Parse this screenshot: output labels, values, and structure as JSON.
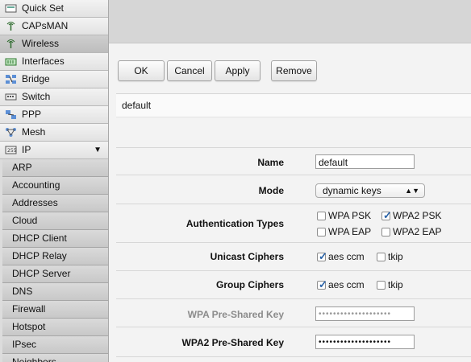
{
  "sidebar": {
    "items": [
      {
        "label": "Quick Set",
        "icon": "quick-set-icon"
      },
      {
        "label": "CAPsMAN",
        "icon": "antenna-icon"
      },
      {
        "label": "Wireless",
        "icon": "wireless-icon",
        "selected": true
      },
      {
        "label": "Interfaces",
        "icon": "interfaces-icon"
      },
      {
        "label": "Bridge",
        "icon": "bridge-icon"
      },
      {
        "label": "Switch",
        "icon": "switch-icon"
      },
      {
        "label": "PPP",
        "icon": "ppp-icon"
      },
      {
        "label": "Mesh",
        "icon": "mesh-icon"
      },
      {
        "label": "IP",
        "icon": "ip-icon",
        "expand_arrow": "▼"
      }
    ],
    "ip_subitems": [
      "ARP",
      "Accounting",
      "Addresses",
      "Cloud",
      "DHCP Client",
      "DHCP Relay",
      "DHCP Server",
      "DNS",
      "Firewall",
      "Hotspot",
      "IPsec",
      "Neighbors"
    ]
  },
  "toolbar": {
    "ok_label": "OK",
    "cancel_label": "Cancel",
    "apply_label": "Apply",
    "remove_label": "Remove"
  },
  "record_title": "default",
  "form": {
    "name_label": "Name",
    "name_value": "default",
    "mode_label": "Mode",
    "mode_value": "dynamic keys",
    "auth_label": "Authentication Types",
    "auth_options": [
      {
        "label": "WPA PSK",
        "checked": false
      },
      {
        "label": "WPA2 PSK",
        "checked": true
      },
      {
        "label": "WPA EAP",
        "checked": false
      },
      {
        "label": "WPA2 EAP",
        "checked": false
      }
    ],
    "unicast_label": "Unicast Ciphers",
    "unicast_options": [
      {
        "label": "aes ccm",
        "checked": true
      },
      {
        "label": "tkip",
        "checked": false
      }
    ],
    "group_label": "Group Ciphers",
    "group_options": [
      {
        "label": "aes ccm",
        "checked": true
      },
      {
        "label": "tkip",
        "checked": false
      }
    ],
    "wpa_psk_label": "WPA Pre-Shared Key",
    "wpa_psk_value": "••••••••••••••••••••",
    "wpa2_psk_label": "WPA2 Pre-Shared Key",
    "wpa2_psk_value": "••••••••••••••••••••"
  },
  "colors": {
    "check": "#2a63a8",
    "selected_item": "#c4c4c4"
  }
}
